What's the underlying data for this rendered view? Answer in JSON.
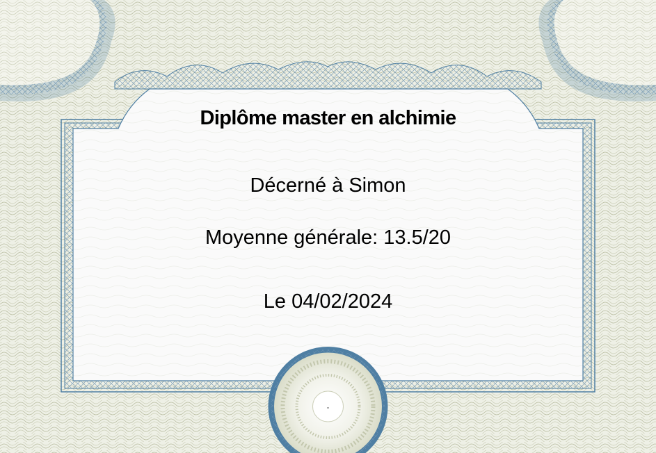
{
  "certificate": {
    "title": "Diplôme master en alchimie",
    "recipient_line": "Décerné à Simon",
    "grade_line": "Moyenne générale: 13.5/20",
    "date_line": "Le 04/02/2024"
  },
  "colors": {
    "border_guilloche": "#b3b89a",
    "border_blue": "#4f7fa3",
    "paper": "#fafafa"
  }
}
